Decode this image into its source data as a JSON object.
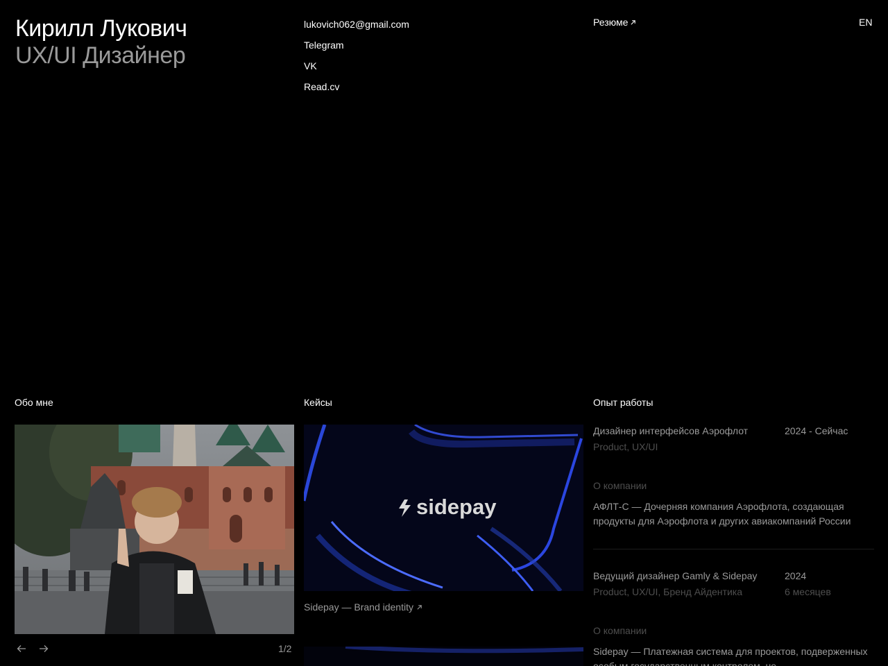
{
  "header": {
    "name": "Кирилл Лукович",
    "role": "UX/UI Дизайнер",
    "contacts": [
      "lukovich062@gmail.com",
      "Telegram",
      "VK",
      "Read.cv"
    ],
    "resume_label": "Резюме",
    "lang_label": "EN"
  },
  "sections": {
    "about_title": "Обо мне",
    "cases_title": "Кейсы",
    "experience_title": "Опыт работы"
  },
  "about": {
    "gallery_counter": "1/2",
    "prev_icon": "arrow-left-icon",
    "next_icon": "arrow-right-icon"
  },
  "cases": [
    {
      "logo_text": "sidepay",
      "caption": "Sidepay — Brand identity"
    }
  ],
  "experience": [
    {
      "title": "Дизайнер интерфейсов Аэрофлот",
      "period": "2024 - Сейчас",
      "tags": "Product, UX/UI",
      "duration": "",
      "about_label": "О компании",
      "about_text": "АФЛТ-С — Дочерняя компания Аэрофлота, создающая продукты для Аэрофлота и других авиакомпаний России"
    },
    {
      "title": "Ведущий дизайнер Gamly & Sidepay",
      "period": "2024",
      "tags": "Product, UX/UI, Бренд Айдентика",
      "duration": "6 месяцев",
      "about_label": "О компании",
      "about_text": "Sidepay — Платежная система для проектов, подверженных особым государственным контролем, не"
    }
  ],
  "colors": {
    "background": "#000000",
    "text_primary": "#ffffff",
    "text_secondary": "#9a9a9a",
    "text_muted": "#4e4e4e"
  }
}
